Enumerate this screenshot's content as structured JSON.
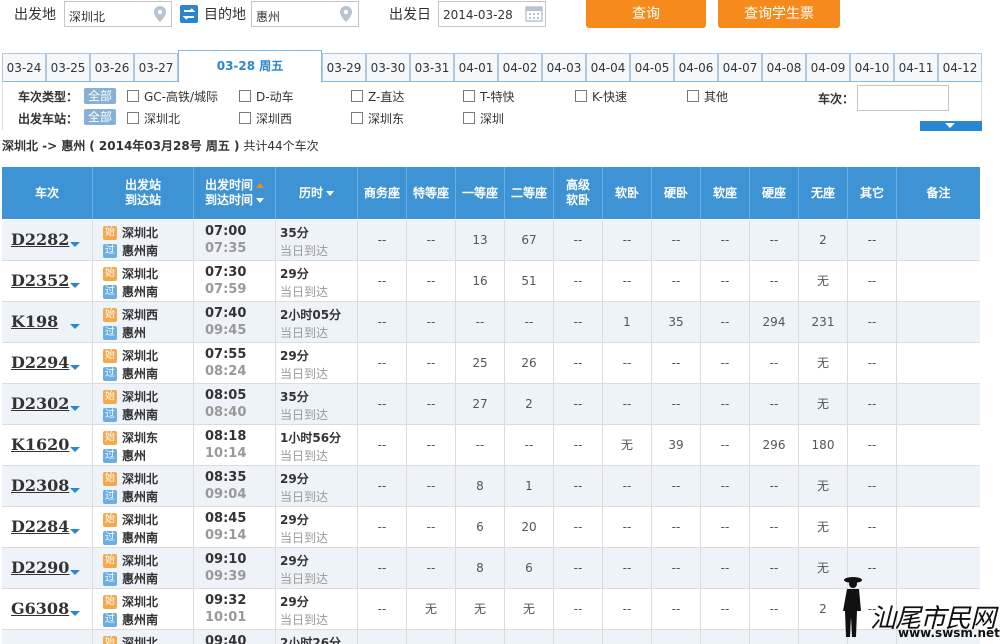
{
  "search": {
    "from_label": "出发地",
    "from_value": "深圳北",
    "to_label": "目的地",
    "to_value": "惠州",
    "date_label": "出发日",
    "date_value": "2014-03-28",
    "query_btn": "查询",
    "student_btn": "查询学生票"
  },
  "dates": [
    "03-24",
    "03-25",
    "03-26",
    "03-27",
    "03-28 周五",
    "03-29",
    "03-30",
    "03-31",
    "04-01",
    "04-02",
    "04-03",
    "04-04",
    "04-05",
    "04-06",
    "04-07",
    "04-08",
    "04-09",
    "04-10",
    "04-11",
    "04-12"
  ],
  "active_date_index": 4,
  "filters": {
    "type_label": "车次类型：",
    "station_label": "出发车站：",
    "all": "全部",
    "types": [
      "GC-高铁/城际",
      "D-动车",
      "Z-直达",
      "T-特快",
      "K-快速",
      "其他"
    ],
    "stations": [
      "深圳北",
      "深圳西",
      "深圳东",
      "深圳"
    ],
    "train_no_label": "车次："
  },
  "summary": {
    "route": "深圳北 -> 惠州",
    "date_text": "( 2014年03月28号  周五 )",
    "count_text": "共计44个车次"
  },
  "table": {
    "headers": {
      "train": "车次",
      "station1": "出发站",
      "station2": "到达站",
      "time1": "出发时间",
      "time2": "到达时间",
      "duration": "历时",
      "business": "商务座",
      "special": "特等座",
      "first": "一等座",
      "second": "二等座",
      "premium1": "高级",
      "premium2": "软卧",
      "softsleeper": "软卧",
      "hardsleeper": "硬卧",
      "softseat": "软座",
      "hardseat": "硬座",
      "noseat": "无座",
      "other": "其它",
      "remark": "备注"
    },
    "badge_start": "始",
    "badge_pass": "过",
    "rows": [
      {
        "no": "D2282",
        "from": "深圳北",
        "from_badge": "始",
        "to": "惠州南",
        "to_badge": "过",
        "dep": "07:00",
        "arr": "07:35",
        "dur": "35分",
        "note": "当日到达",
        "seats": [
          "--",
          "--",
          "13",
          "67",
          "--",
          "--",
          "--",
          "--",
          "--",
          "2",
          "--"
        ]
      },
      {
        "no": "D2352",
        "from": "深圳北",
        "from_badge": "始",
        "to": "惠州南",
        "to_badge": "过",
        "dep": "07:30",
        "arr": "07:59",
        "dur": "29分",
        "note": "当日到达",
        "seats": [
          "--",
          "--",
          "16",
          "51",
          "--",
          "--",
          "--",
          "--",
          "--",
          "无",
          "--"
        ]
      },
      {
        "no": "K198",
        "from": "深圳西",
        "from_badge": "始",
        "to": "惠州",
        "to_badge": "过",
        "dep": "07:40",
        "arr": "09:45",
        "dur": "2小时05分",
        "note": "当日到达",
        "seats": [
          "--",
          "--",
          "--",
          "--",
          "--",
          "1",
          "35",
          "--",
          "294",
          "231",
          "--"
        ]
      },
      {
        "no": "D2294",
        "from": "深圳北",
        "from_badge": "始",
        "to": "惠州南",
        "to_badge": "过",
        "dep": "07:55",
        "arr": "08:24",
        "dur": "29分",
        "note": "当日到达",
        "seats": [
          "--",
          "--",
          "25",
          "26",
          "--",
          "--",
          "--",
          "--",
          "--",
          "无",
          "--"
        ]
      },
      {
        "no": "D2302",
        "from": "深圳北",
        "from_badge": "始",
        "to": "惠州南",
        "to_badge": "过",
        "dep": "08:05",
        "arr": "08:40",
        "dur": "35分",
        "note": "当日到达",
        "seats": [
          "--",
          "--",
          "27",
          "2",
          "--",
          "--",
          "--",
          "--",
          "--",
          "无",
          "--"
        ]
      },
      {
        "no": "K1620",
        "from": "深圳东",
        "from_badge": "始",
        "to": "惠州",
        "to_badge": "过",
        "dep": "08:18",
        "arr": "10:14",
        "dur": "1小时56分",
        "note": "当日到达",
        "seats": [
          "--",
          "--",
          "--",
          "--",
          "--",
          "无",
          "39",
          "--",
          "296",
          "180",
          "--"
        ]
      },
      {
        "no": "D2308",
        "from": "深圳北",
        "from_badge": "始",
        "to": "惠州南",
        "to_badge": "过",
        "dep": "08:35",
        "arr": "09:04",
        "dur": "29分",
        "note": "当日到达",
        "seats": [
          "--",
          "--",
          "8",
          "1",
          "--",
          "--",
          "--",
          "--",
          "--",
          "无",
          "--"
        ]
      },
      {
        "no": "D2284",
        "from": "深圳北",
        "from_badge": "始",
        "to": "惠州南",
        "to_badge": "过",
        "dep": "08:45",
        "arr": "09:14",
        "dur": "29分",
        "note": "当日到达",
        "seats": [
          "--",
          "--",
          "6",
          "20",
          "--",
          "--",
          "--",
          "--",
          "--",
          "无",
          "--"
        ]
      },
      {
        "no": "D2290",
        "from": "深圳北",
        "from_badge": "始",
        "to": "惠州南",
        "to_badge": "过",
        "dep": "09:10",
        "arr": "09:39",
        "dur": "29分",
        "note": "当日到达",
        "seats": [
          "--",
          "--",
          "8",
          "6",
          "--",
          "--",
          "--",
          "--",
          "--",
          "无",
          "--"
        ]
      },
      {
        "no": "G6308",
        "from": "深圳北",
        "from_badge": "始",
        "to": "惠州南",
        "to_badge": "过",
        "dep": "09:32",
        "arr": "10:01",
        "dur": "29分",
        "note": "当日到达",
        "seats": [
          "--",
          "无",
          "无",
          "无",
          "--",
          "--",
          "--",
          "--",
          "--",
          "2",
          "--"
        ]
      },
      {
        "no": "",
        "from": "深圳北",
        "from_badge": "始",
        "to": "",
        "to_badge": "",
        "dep": "09:40",
        "arr": "",
        "dur": "2小时26分",
        "note": "",
        "seats": [
          "--",
          "--",
          "--",
          "--",
          "--",
          "--",
          "--",
          "--",
          "--",
          "--",
          "--"
        ]
      }
    ]
  },
  "watermark": {
    "text": "汕尾市民网",
    "url": "www.swsm.net"
  }
}
